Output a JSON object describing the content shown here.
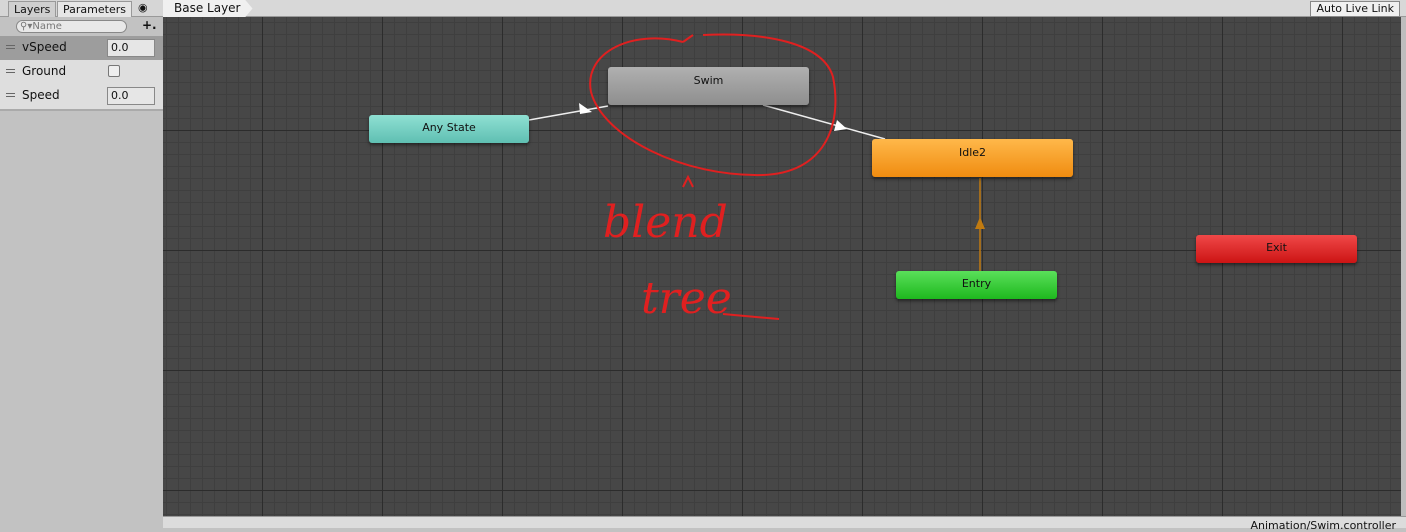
{
  "tabs": [
    {
      "label": "Layers"
    },
    {
      "label": "Parameters"
    }
  ],
  "eye_icon": "eye-icon",
  "search": {
    "placeholder": "Name"
  },
  "add_label": "+.",
  "parameters": [
    {
      "name": "vSpeed",
      "type": "float",
      "value": "0.0",
      "selected": true
    },
    {
      "name": "Ground",
      "type": "bool",
      "value": false
    },
    {
      "name": "Speed",
      "type": "float",
      "value": "0.0"
    }
  ],
  "breadcrumb": "Base Layer",
  "auto_live_link": "Auto Live Link",
  "states": {
    "any_state": {
      "label": "Any State",
      "color": "#6ecabd"
    },
    "swim": {
      "label": "Swim",
      "color": "#9a9a9a"
    },
    "idle2": {
      "label": "Idle2",
      "color": "#f49a1c"
    },
    "entry": {
      "label": "Entry",
      "color": "#25c625"
    },
    "exit": {
      "label": "Exit",
      "color": "#dd2222"
    }
  },
  "annotation": {
    "line1": "blend",
    "line2": "tree",
    "color": "#e02020"
  },
  "status_path": "Animation/Swim.controller"
}
